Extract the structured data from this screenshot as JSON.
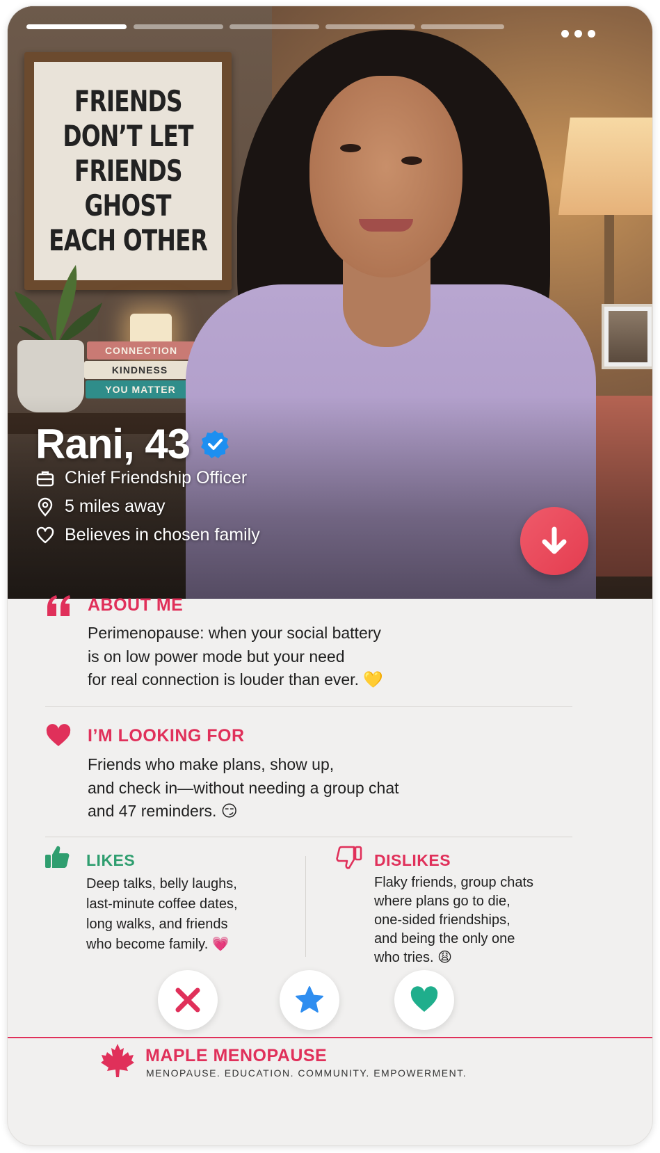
{
  "profile": {
    "name_age": "Rani, 43",
    "job": "Chief Friendship Officer",
    "distance": "5 miles away",
    "belief": "Believes in chosen family",
    "photo_count": 5,
    "active_photo": 1
  },
  "photo_sign": {
    "lines": [
      "FRIENDS",
      "DON’T LET",
      "FRIENDS",
      "GHOST",
      "EACH OTHER"
    ]
  },
  "books": [
    "CONNECTION",
    "KINDNESS",
    "YOU MATTER"
  ],
  "about": {
    "title": "ABOUT ME",
    "text": "Perimenopause: when your social battery\nis on low power mode but your need\nfor real connection is louder than ever. 💛"
  },
  "looking_for": {
    "title": "I’M LOOKING FOR",
    "text": "Friends who make plans, show up,\nand check in—without needing a group chat\nand 47 reminders. 😏"
  },
  "likes": {
    "title": "LIKES",
    "text": "Deep talks, belly laughs,\nlast-minute coffee dates,\nlong walks, and friends\nwho become family. 💗"
  },
  "dislikes": {
    "title": "DISLIKES",
    "text": "Flaky friends, group chats\nwhere plans go to die,\none-sided friendships,\nand being the only one\nwho tries. 😩"
  },
  "footer": {
    "brand": "MAPLE MENOPAUSE",
    "tagline": "MENOPAUSE. EDUCATION. COMMUNITY. EMPOWERMENT."
  },
  "colors": {
    "accent_pink": "#e0305a",
    "like_green": "#2f9e6f",
    "verified_blue": "#1d8ff0",
    "star_blue": "#2f8ef0",
    "heart_teal": "#1fae8c"
  },
  "icons": {
    "quote": "quote-icon",
    "heart": "heart-icon",
    "thumbs_up": "thumbs-up-icon",
    "thumbs_down": "thumbs-down-icon",
    "briefcase": "briefcase-icon",
    "location": "location-pin-icon",
    "verified": "verified-badge-icon",
    "expand": "arrow-down-icon",
    "reject": "x-icon",
    "super_like": "star-icon",
    "like": "heart-icon",
    "logo": "maple-leaf-icon"
  }
}
